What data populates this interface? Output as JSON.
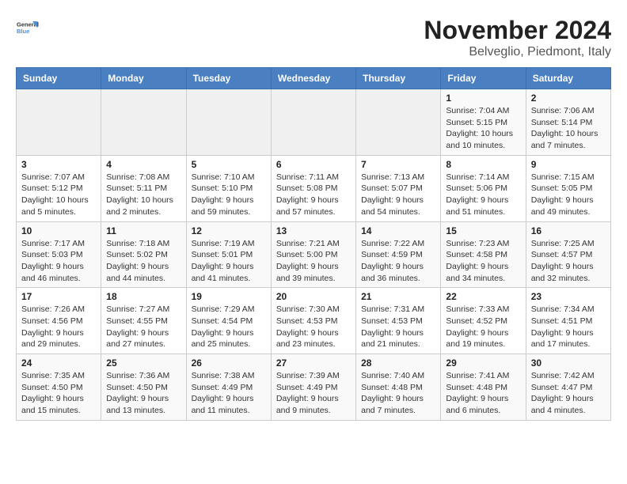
{
  "header": {
    "logo_line1": "General",
    "logo_line2": "Blue",
    "title": "November 2024",
    "subtitle": "Belveglio, Piedmont, Italy"
  },
  "calendar": {
    "headers": [
      "Sunday",
      "Monday",
      "Tuesday",
      "Wednesday",
      "Thursday",
      "Friday",
      "Saturday"
    ],
    "weeks": [
      [
        {
          "day": "",
          "info": ""
        },
        {
          "day": "",
          "info": ""
        },
        {
          "day": "",
          "info": ""
        },
        {
          "day": "",
          "info": ""
        },
        {
          "day": "",
          "info": ""
        },
        {
          "day": "1",
          "info": "Sunrise: 7:04 AM\nSunset: 5:15 PM\nDaylight: 10 hours and 10 minutes."
        },
        {
          "day": "2",
          "info": "Sunrise: 7:06 AM\nSunset: 5:14 PM\nDaylight: 10 hours and 7 minutes."
        }
      ],
      [
        {
          "day": "3",
          "info": "Sunrise: 7:07 AM\nSunset: 5:12 PM\nDaylight: 10 hours and 5 minutes."
        },
        {
          "day": "4",
          "info": "Sunrise: 7:08 AM\nSunset: 5:11 PM\nDaylight: 10 hours and 2 minutes."
        },
        {
          "day": "5",
          "info": "Sunrise: 7:10 AM\nSunset: 5:10 PM\nDaylight: 9 hours and 59 minutes."
        },
        {
          "day": "6",
          "info": "Sunrise: 7:11 AM\nSunset: 5:08 PM\nDaylight: 9 hours and 57 minutes."
        },
        {
          "day": "7",
          "info": "Sunrise: 7:13 AM\nSunset: 5:07 PM\nDaylight: 9 hours and 54 minutes."
        },
        {
          "day": "8",
          "info": "Sunrise: 7:14 AM\nSunset: 5:06 PM\nDaylight: 9 hours and 51 minutes."
        },
        {
          "day": "9",
          "info": "Sunrise: 7:15 AM\nSunset: 5:05 PM\nDaylight: 9 hours and 49 minutes."
        }
      ],
      [
        {
          "day": "10",
          "info": "Sunrise: 7:17 AM\nSunset: 5:03 PM\nDaylight: 9 hours and 46 minutes."
        },
        {
          "day": "11",
          "info": "Sunrise: 7:18 AM\nSunset: 5:02 PM\nDaylight: 9 hours and 44 minutes."
        },
        {
          "day": "12",
          "info": "Sunrise: 7:19 AM\nSunset: 5:01 PM\nDaylight: 9 hours and 41 minutes."
        },
        {
          "day": "13",
          "info": "Sunrise: 7:21 AM\nSunset: 5:00 PM\nDaylight: 9 hours and 39 minutes."
        },
        {
          "day": "14",
          "info": "Sunrise: 7:22 AM\nSunset: 4:59 PM\nDaylight: 9 hours and 36 minutes."
        },
        {
          "day": "15",
          "info": "Sunrise: 7:23 AM\nSunset: 4:58 PM\nDaylight: 9 hours and 34 minutes."
        },
        {
          "day": "16",
          "info": "Sunrise: 7:25 AM\nSunset: 4:57 PM\nDaylight: 9 hours and 32 minutes."
        }
      ],
      [
        {
          "day": "17",
          "info": "Sunrise: 7:26 AM\nSunset: 4:56 PM\nDaylight: 9 hours and 29 minutes."
        },
        {
          "day": "18",
          "info": "Sunrise: 7:27 AM\nSunset: 4:55 PM\nDaylight: 9 hours and 27 minutes."
        },
        {
          "day": "19",
          "info": "Sunrise: 7:29 AM\nSunset: 4:54 PM\nDaylight: 9 hours and 25 minutes."
        },
        {
          "day": "20",
          "info": "Sunrise: 7:30 AM\nSunset: 4:53 PM\nDaylight: 9 hours and 23 minutes."
        },
        {
          "day": "21",
          "info": "Sunrise: 7:31 AM\nSunset: 4:53 PM\nDaylight: 9 hours and 21 minutes."
        },
        {
          "day": "22",
          "info": "Sunrise: 7:33 AM\nSunset: 4:52 PM\nDaylight: 9 hours and 19 minutes."
        },
        {
          "day": "23",
          "info": "Sunrise: 7:34 AM\nSunset: 4:51 PM\nDaylight: 9 hours and 17 minutes."
        }
      ],
      [
        {
          "day": "24",
          "info": "Sunrise: 7:35 AM\nSunset: 4:50 PM\nDaylight: 9 hours and 15 minutes."
        },
        {
          "day": "25",
          "info": "Sunrise: 7:36 AM\nSunset: 4:50 PM\nDaylight: 9 hours and 13 minutes."
        },
        {
          "day": "26",
          "info": "Sunrise: 7:38 AM\nSunset: 4:49 PM\nDaylight: 9 hours and 11 minutes."
        },
        {
          "day": "27",
          "info": "Sunrise: 7:39 AM\nSunset: 4:49 PM\nDaylight: 9 hours and 9 minutes."
        },
        {
          "day": "28",
          "info": "Sunrise: 7:40 AM\nSunset: 4:48 PM\nDaylight: 9 hours and 7 minutes."
        },
        {
          "day": "29",
          "info": "Sunrise: 7:41 AM\nSunset: 4:48 PM\nDaylight: 9 hours and 6 minutes."
        },
        {
          "day": "30",
          "info": "Sunrise: 7:42 AM\nSunset: 4:47 PM\nDaylight: 9 hours and 4 minutes."
        }
      ]
    ]
  }
}
